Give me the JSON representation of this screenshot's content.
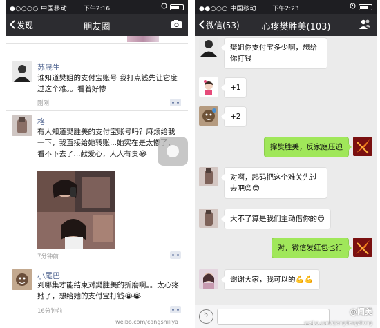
{
  "left": {
    "status": {
      "carrier": "●○○○○ 中国移动",
      "time": "下午2:16"
    },
    "nav": {
      "back": "发现",
      "title": "朋友圈"
    },
    "posts": [
      {
        "name": "苏晟生",
        "text": "谁知道樊姐的支付宝账号 我打点钱先让它度过这个难。。看着好惨",
        "time": "刚刚"
      },
      {
        "name": "格",
        "text": "有人知道樊胜美的支付宝账号吗？麻烦给我一下，我直接给她转账...她实在是太惨了，看不下去了...献爱心，人人有责😂",
        "time": "7分钟前"
      },
      {
        "name": "小尾巴",
        "text": "到哪集才能结束对樊胜美的折磨啊。。太心疼她了，想给她的支付宝打钱😭😭",
        "time": "16分钟前"
      }
    ],
    "watermark": "weibo.com/cangshiliya"
  },
  "right": {
    "status": {
      "carrier": "●●○○○ 中国移动",
      "time": "下午2:23"
    },
    "nav": {
      "back": "微信(53)",
      "title": "心疼樊胜美(103)"
    },
    "messages": [
      {
        "side": "in",
        "text": "樊姐你支付宝多少啊，想给你打钱"
      },
      {
        "side": "in",
        "text": "+1"
      },
      {
        "side": "in",
        "text": "+2"
      },
      {
        "side": "out",
        "text": "撑樊胜美，反家庭压迫"
      },
      {
        "side": "in",
        "text": "对啊，起码把这个难关先过去吧😊😊"
      },
      {
        "side": "in",
        "text": "大不了算是我们主动借你的😊"
      },
      {
        "side": "out",
        "text": "对，微信发红包也行"
      },
      {
        "side": "in",
        "text": "谢谢大家，我可以的💪💪"
      }
    ],
    "watermark": "@闻美",
    "watermark_sub": "weibo.com/qiangdengzhong"
  }
}
